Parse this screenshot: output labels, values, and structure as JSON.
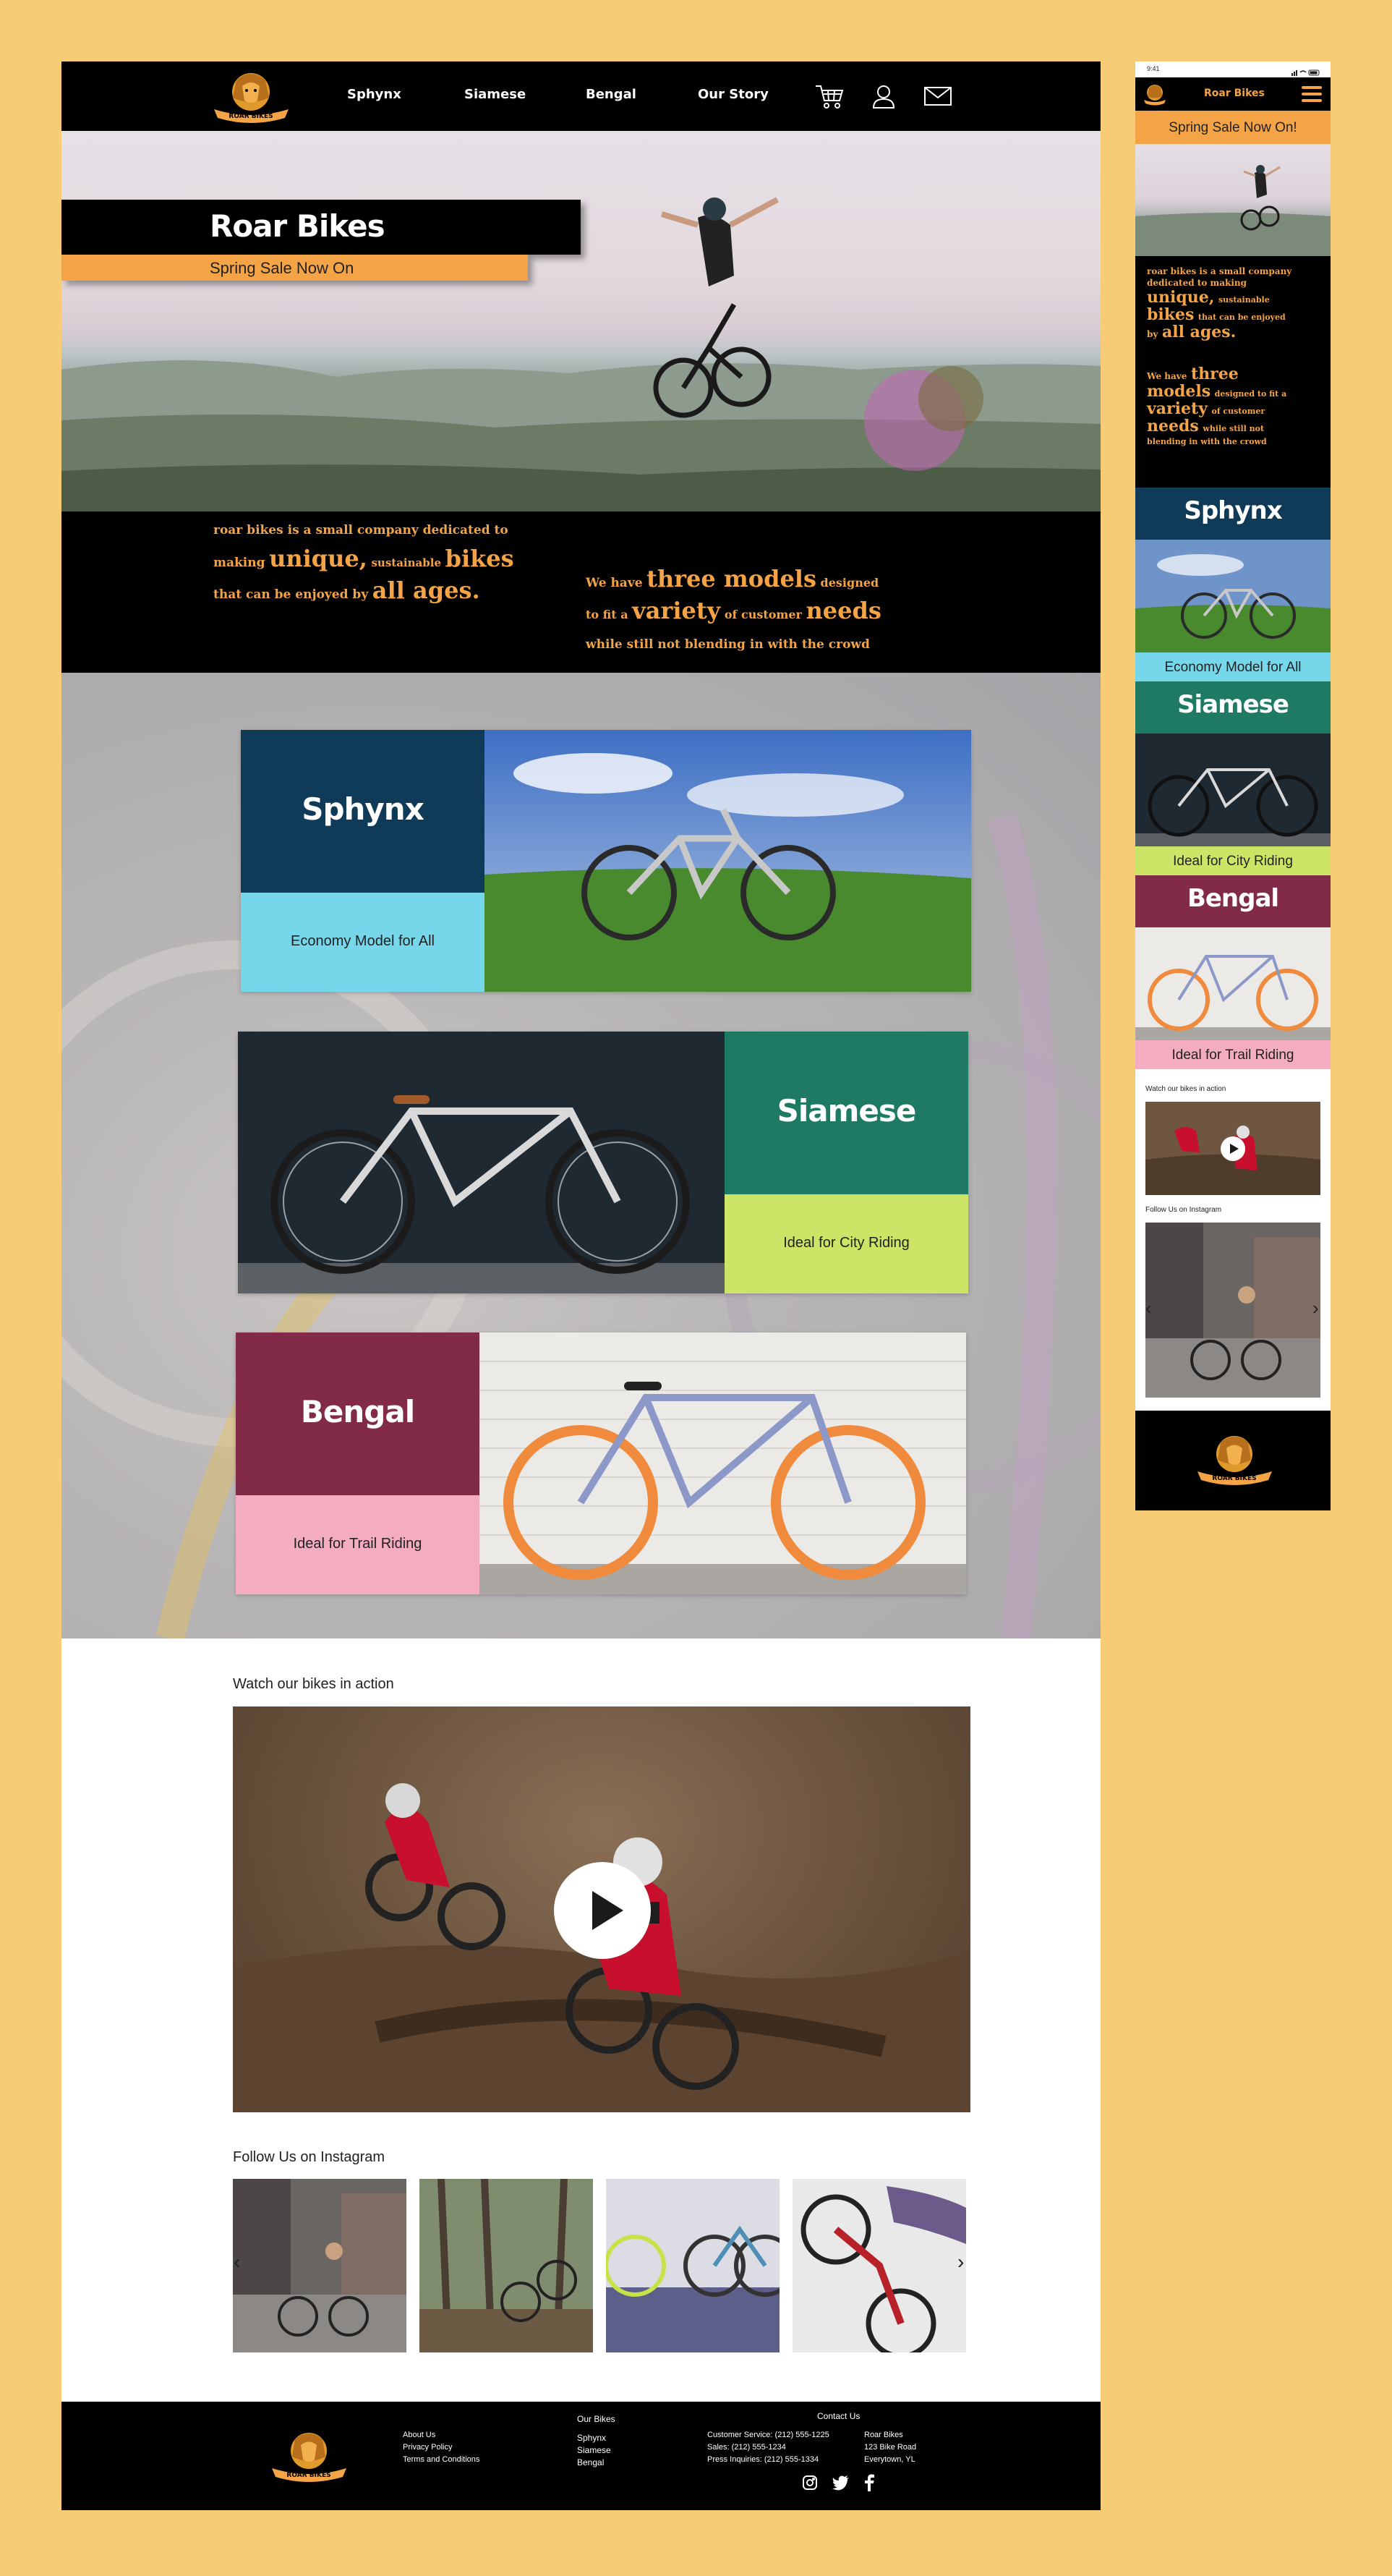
{
  "brand": {
    "name": "Roar Bikes",
    "logo_text": "ROAR BIKES",
    "colors": {
      "orange": "#f4a446",
      "black": "#000000",
      "sphynx": "#0f3a58",
      "sphynx_tag": "#76d7ea",
      "siamese": "#1e7a62",
      "siamese_tag": "#cde567",
      "bengal": "#812b48",
      "bengal_tag": "#f4acc0"
    }
  },
  "nav": {
    "items": [
      {
        "label": "Sphynx"
      },
      {
        "label": "Siamese"
      },
      {
        "label": "Bengal"
      },
      {
        "label": "Our Story"
      }
    ],
    "icons": [
      "cart-icon",
      "user-icon",
      "mail-icon"
    ]
  },
  "hero": {
    "title": "Roar Bikes",
    "subtitle": "Spring Sale Now On"
  },
  "intro": {
    "left": {
      "l1": "roar bikes is a small company dedicated to",
      "l2a": "making",
      "l2b": "unique,",
      "l2c": "sustainable",
      "l2d": "bikes",
      "l3a": "that can be enjoyed by",
      "l3b": "all ages."
    },
    "right": {
      "l1a": "We have",
      "l1b": "three models",
      "l1c": "designed",
      "l2a": "to fit a",
      "l2b": "variety",
      "l2c": "of customer",
      "l2d": "needs",
      "l3": "while still not blending in with the crowd"
    }
  },
  "bikes": [
    {
      "name": "Sphynx",
      "tagline": "Economy Model for All"
    },
    {
      "name": "Siamese",
      "tagline": "Ideal for City Riding"
    },
    {
      "name": "Bengal",
      "tagline": "Ideal for Trail Riding"
    }
  ],
  "video": {
    "label": "Watch our bikes in action"
  },
  "instagram": {
    "label": "Follow Us on Instagram",
    "prev": "‹",
    "next": "›"
  },
  "footer": {
    "links": [
      "About Us",
      "Privacy Policy",
      "Terms and Conditions"
    ],
    "our_bikes_heading": "Our Bikes",
    "our_bikes": [
      "Sphynx",
      "Siamese",
      "Bengal"
    ],
    "contact_heading": "Contact Us",
    "contact_lines": [
      "Customer Service: (212) 555-1225",
      "Sales: (212) 555-1234",
      "Press Inquiries: (212) 555-1334"
    ],
    "address": [
      "Roar Bikes",
      "123 Bike Road",
      "Everytown, YL"
    ],
    "social_icons": [
      "instagram-icon",
      "twitter-icon",
      "facebook-icon"
    ]
  },
  "mobile": {
    "time": "9:41",
    "brand": "Roar Bikes",
    "sale": "Spring Sale Now On!",
    "intro": {
      "a1": "roar bikes is a small company",
      "a2": "dedicated to making",
      "a3a": "unique,",
      "a3b": "sustainable",
      "a4a": "bikes",
      "a4b": "that can be enjoyed",
      "a5a": "by",
      "a5b": "all ages.",
      "b1a": "We have",
      "b1b": "three",
      "b2a": "models",
      "b2b": "designed to fit a",
      "b3a": "variety",
      "b3b": "of customer",
      "b4a": "needs",
      "b4b": "while still not",
      "b5": "blending in with the crowd"
    },
    "video_label": "Watch our bikes in action",
    "insta_label": "Follow Us on Instagram",
    "prev": "‹",
    "next": "›"
  }
}
